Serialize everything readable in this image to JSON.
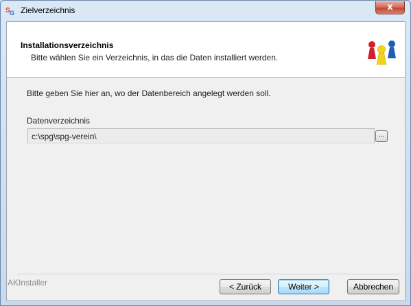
{
  "window": {
    "title": "Zielverzeichnis",
    "close_glyph": "x"
  },
  "header": {
    "title": "Installationsverzeichnis",
    "subtitle": "Bitte wählen Sie ein Verzeichnis, in das die Daten installiert werden."
  },
  "body": {
    "info_text": "Bitte geben Sie hier an, wo der Datenbereich angelegt werden soll.",
    "directory_label": "Datenverzeichnis",
    "directory_value": "c:\\spg\\spg-verein\\",
    "browse_label": "..."
  },
  "footer": {
    "brand": "AKInstaller",
    "back_label": "< Zurück",
    "next_label": "Weiter >",
    "cancel_label": "Abbrechen"
  },
  "icons": {
    "app": "spg-app-icon",
    "logo": "game-pieces-icon"
  },
  "colors": {
    "logo_red": "#d4202a",
    "logo_yellow": "#f2d31b",
    "logo_blue": "#1d5fb4"
  }
}
